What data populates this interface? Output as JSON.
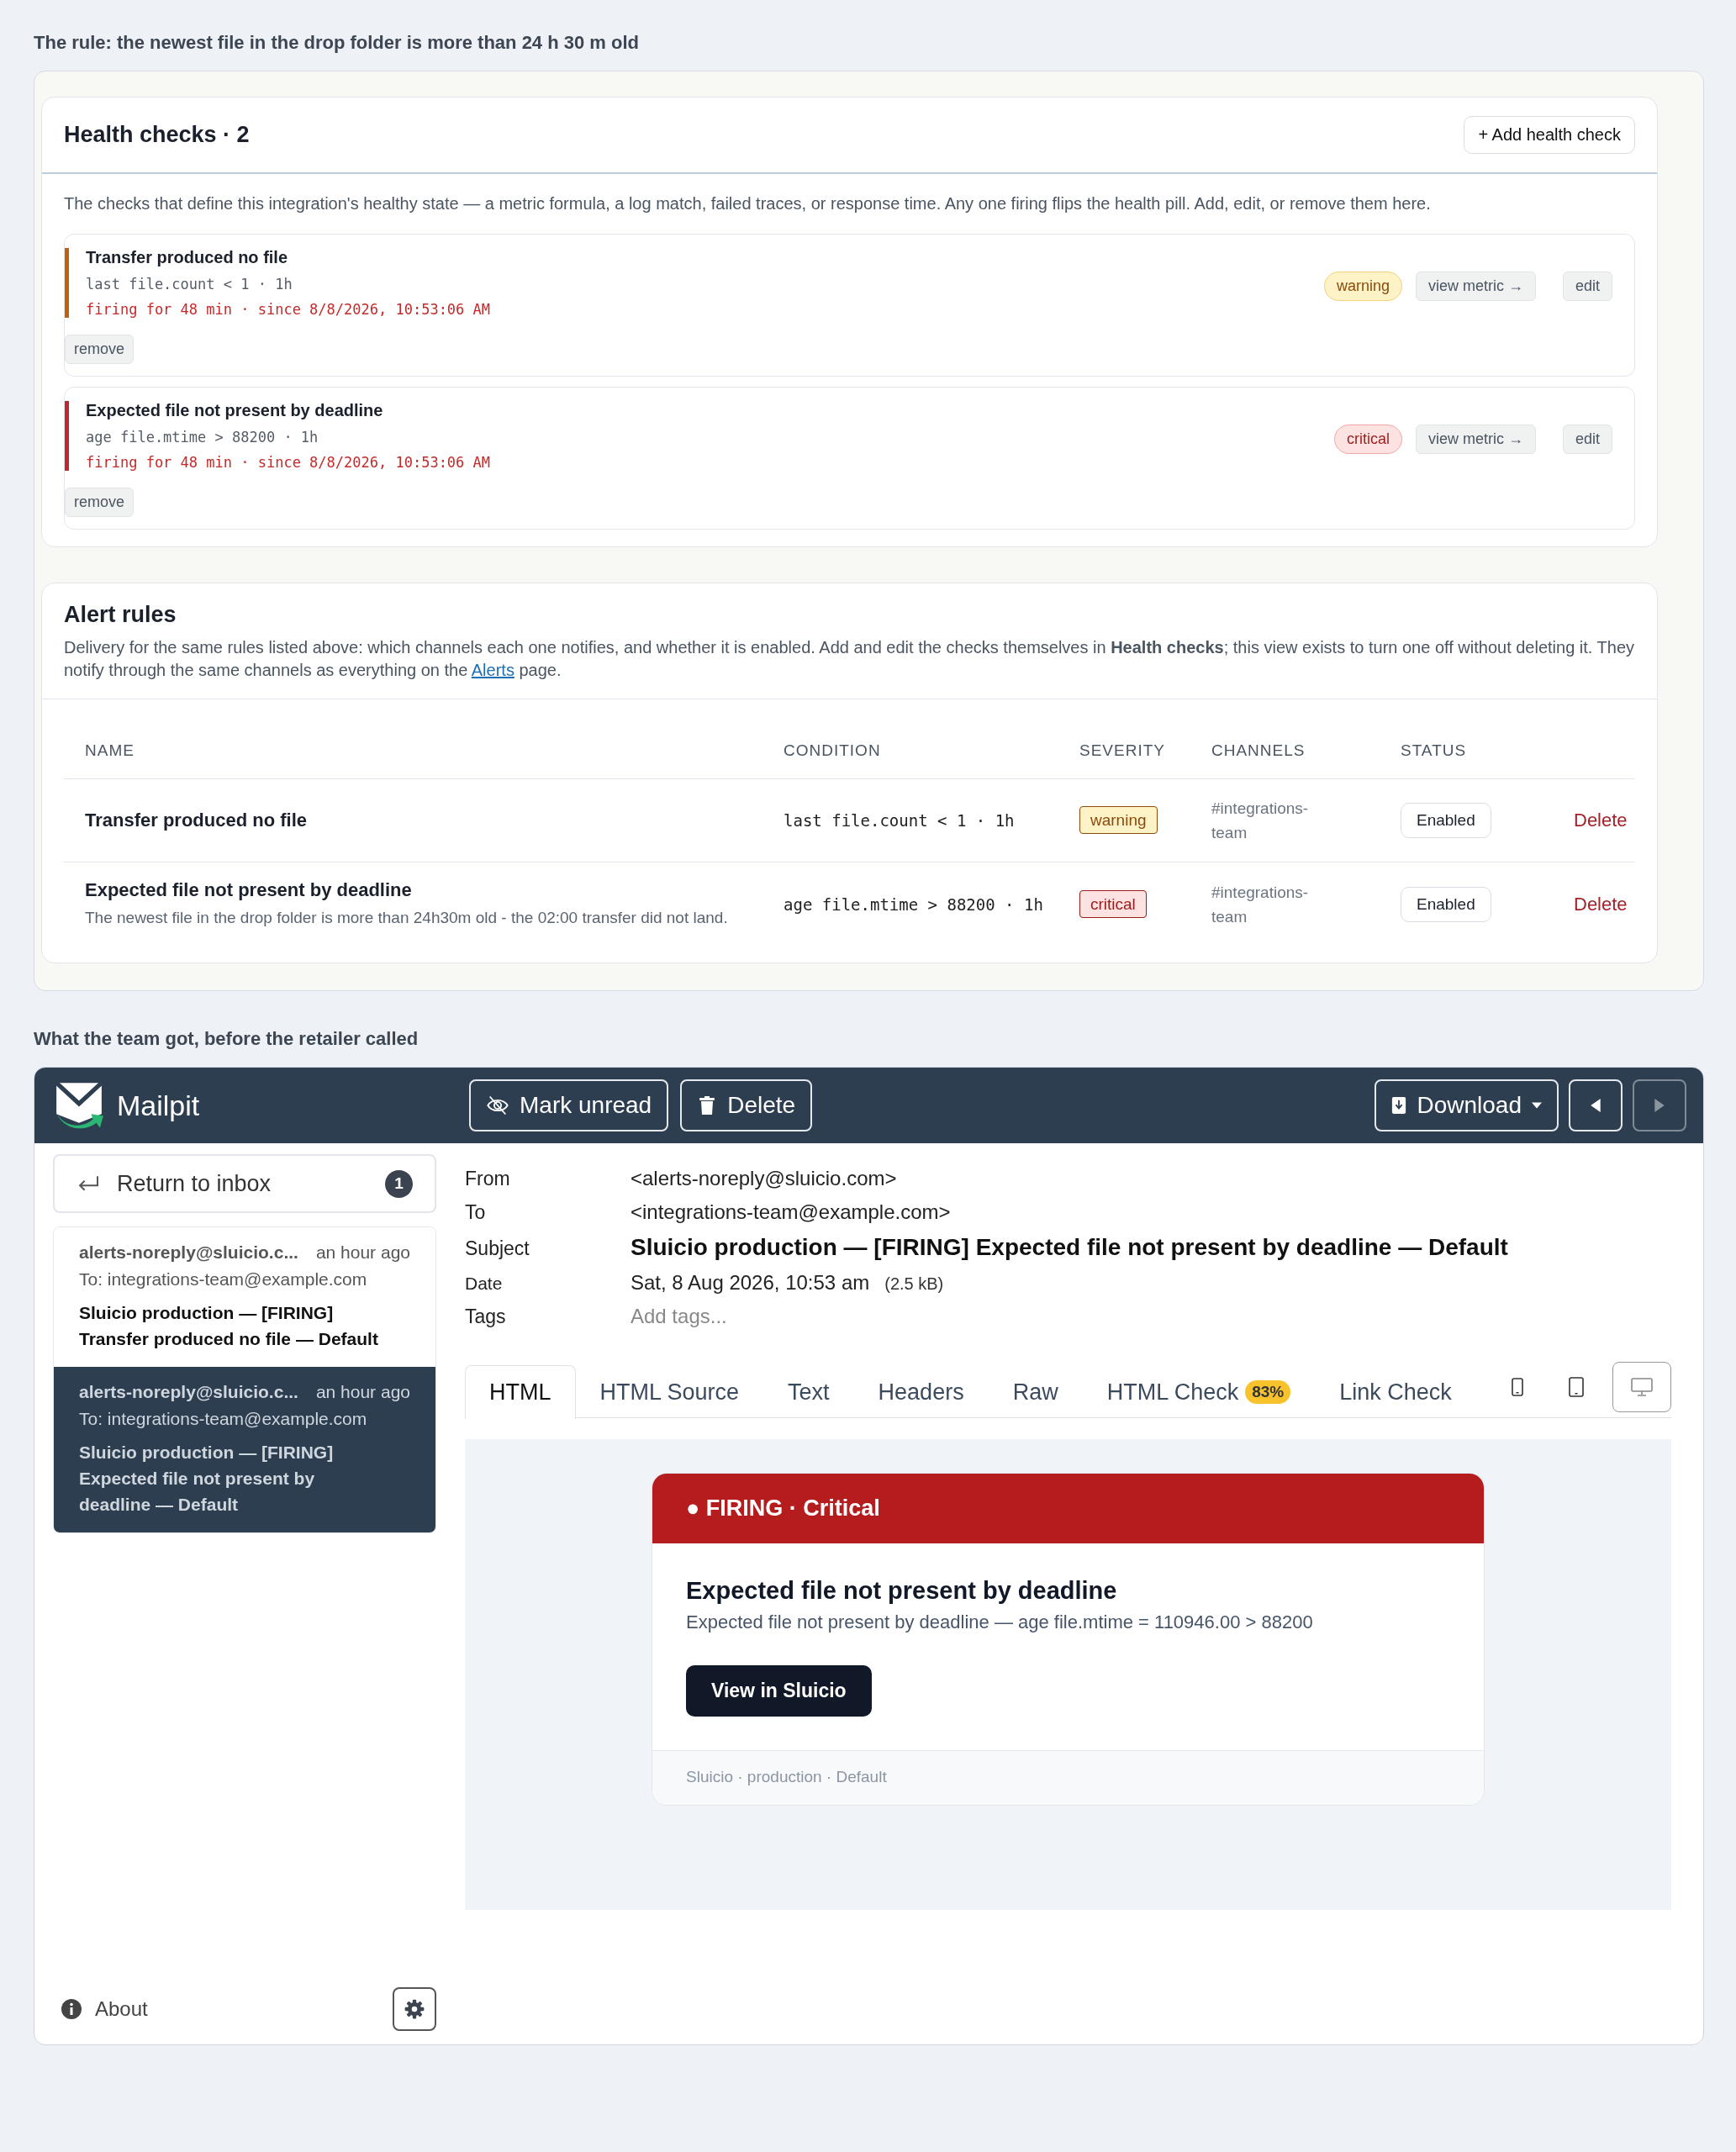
{
  "rule_heading": "The rule: the newest file in the drop folder is more than 24 h 30 m old",
  "health_checks": {
    "title": "Health checks · 2",
    "add_button": "+ Add health check",
    "description": "The checks that define this integration's healthy state — a metric formula, a log match, failed traces, or response time. Any one firing flips the health pill. Add, edit, or remove them here.",
    "checks": [
      {
        "name": "Transfer produced no file",
        "condition": "last file.count < 1 · 1h",
        "firing": "firing for 48 min · since 8/8/2026, 10:53:06 AM",
        "color": "#c2610c",
        "severity": {
          "label": "warning",
          "kind": "warning"
        },
        "view_metric": "view metric →",
        "edit": "edit",
        "remove": "remove"
      },
      {
        "name": "Expected file not present by deadline",
        "condition": "age file.mtime > 88200 · 1h",
        "firing": "firing for 48 min · since 8/8/2026, 10:53:06 AM",
        "color": "#c0262d",
        "severity": {
          "label": "critical",
          "kind": "critical"
        },
        "view_metric": "view metric →",
        "edit": "edit",
        "remove": "remove"
      }
    ]
  },
  "alert_rules": {
    "title": "Alert rules",
    "description_before": "Delivery for the same rules listed above: which channels each one notifies, and whether it is enabled. Add and edit the checks themselves in **Health checks**; this view exists to turn one off without deleting it. They notify through the same channels as everything on the ",
    "link": "Alerts",
    "description_after": " page.",
    "columns": [
      "NAME",
      "CONDITION",
      "SEVERITY",
      "CHANNELS",
      "STATUS"
    ],
    "rows": [
      {
        "name": "Transfer produced no file",
        "condition": "last file.count < 1 · 1h",
        "severity": {
          "label": "warning",
          "kind": "warning"
        },
        "channels": "#integrations-team",
        "status": "Enabled",
        "delete": "Delete"
      },
      {
        "name": "Expected file not present by deadline",
        "note": "The newest file in the drop folder is more than 24h30m old - the 02:00 transfer did not land.",
        "condition": "age file.mtime > 88200 · 1h",
        "severity": {
          "label": "critical",
          "kind": "critical"
        },
        "channels": "#integrations-team",
        "status": "Enabled",
        "delete": "Delete"
      }
    ]
  },
  "email_heading": "What the team got, before the retailer called",
  "mailpit": {
    "brand": "Mailpit",
    "mark_unread": "Mark unread",
    "delete": "Delete",
    "download": "Download",
    "pager": [
      {
        "kind": "prev",
        "disabled": false
      },
      {
        "kind": "next",
        "disabled": true
      }
    ],
    "return_to_inbox": "Return to inbox",
    "unread_count": "1",
    "messages": [
      {
        "from": "alerts-noreply@sluicio.c...",
        "time": "an hour ago",
        "to": "To: integrations-team@example.com",
        "subject": "Sluicio production — [FIRING] Transfer produced no file — Default",
        "selected": false
      },
      {
        "from": "alerts-noreply@sluicio.c...",
        "time": "an hour ago",
        "to": "To: integrations-team@example.com",
        "subject": "Sluicio production — [FIRING] Expected file not present by deadline — Default",
        "selected": true
      }
    ],
    "headers": [
      {
        "label": "From",
        "value": "<alerts-noreply@sluicio.com>",
        "kind": "plain"
      },
      {
        "label": "To",
        "value": "<integrations-team@example.com>",
        "kind": "plain"
      },
      {
        "label": "Subject",
        "value": "Sluicio production — [FIRING] Expected file not present by deadline — Default",
        "kind": "subject"
      },
      {
        "label": "Date",
        "value": "Sat, 8 Aug 2026, 10:53 am",
        "size": "(2.5 kB)",
        "kind": "date"
      },
      {
        "label": "Tags",
        "placeholder": "Add tags...",
        "kind": "tags"
      }
    ],
    "tabs": [
      {
        "label": "HTML",
        "selected": true
      },
      {
        "label": "HTML Source",
        "selected": false
      },
      {
        "label": "Text",
        "selected": false
      },
      {
        "label": "Headers",
        "selected": false
      },
      {
        "label": "Raw",
        "selected": false
      },
      {
        "label": "HTML Check",
        "badge": "83%",
        "selected": false
      },
      {
        "label": "Link Check",
        "selected": false
      }
    ],
    "device_views": [
      {
        "kind": "phone",
        "selected": false
      },
      {
        "kind": "tablet",
        "selected": false
      },
      {
        "kind": "desktop",
        "selected": true
      }
    ],
    "email": {
      "banner": "● FIRING · Critical",
      "title": "Expected file not present by deadline",
      "text": "Expected file not present by deadline — age file.mtime = 110946.00 > 88200",
      "button": "View in Sluicio",
      "footer": "Sluicio · production · Default"
    },
    "about": "About"
  }
}
